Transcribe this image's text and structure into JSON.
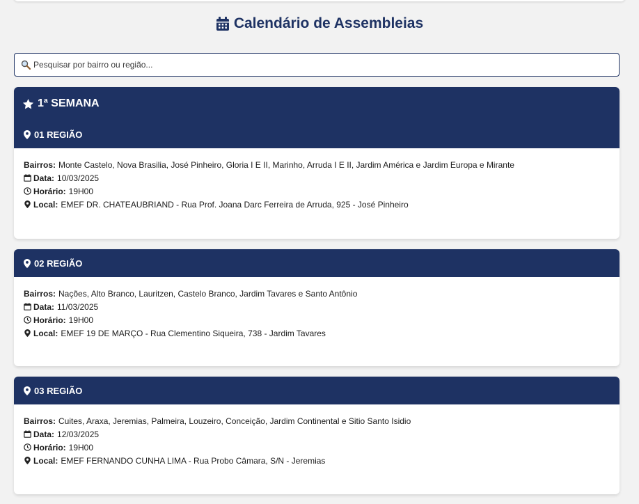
{
  "title": "Calendário de Assembleias",
  "search": {
    "placeholder": "Pesquisar por bairro ou região..."
  },
  "week": {
    "label": "1ª SEMANA"
  },
  "labels": {
    "bairros": "Bairros:",
    "data": "Data:",
    "horario": "Horário:",
    "local": "Local:"
  },
  "regions": [
    {
      "name": "01 REGIÃO",
      "bairros": "Monte Castelo, Nova Brasilia, José Pinheiro, Gloria I E II, Marinho, Arruda I E II, Jardim América e Jardim Europa e Mirante",
      "data": "10/03/2025",
      "horario": "19H00",
      "local": "EMEF DR. CHATEAUBRIAND - Rua Prof. Joana Darc Ferreira de Arruda, 925 - José Pinheiro"
    },
    {
      "name": "02 REGIÃO",
      "bairros": "Nações, Alto Branco, Lauritzen, Castelo Branco, Jardim Tavares e Santo Antônio",
      "data": "11/03/2025",
      "horario": "19H00",
      "local": "EMEF 19 DE MARÇO - Rua Clementino Siqueira, 738 - Jardim Tavares"
    },
    {
      "name": "03 REGIÃO",
      "bairros": "Cuites, Araxa, Jeremias, Palmeira, Louzeiro, Conceição, Jardim Continental e Sitio Santo Isidio",
      "data": "12/03/2025",
      "horario": "19H00",
      "local": "EMEF FERNANDO CUNHA LIMA - Rua Probo Câmara, S/N - Jeremias"
    }
  ],
  "colors": {
    "primary": "#1e3263",
    "background": "#f2f2f2"
  }
}
